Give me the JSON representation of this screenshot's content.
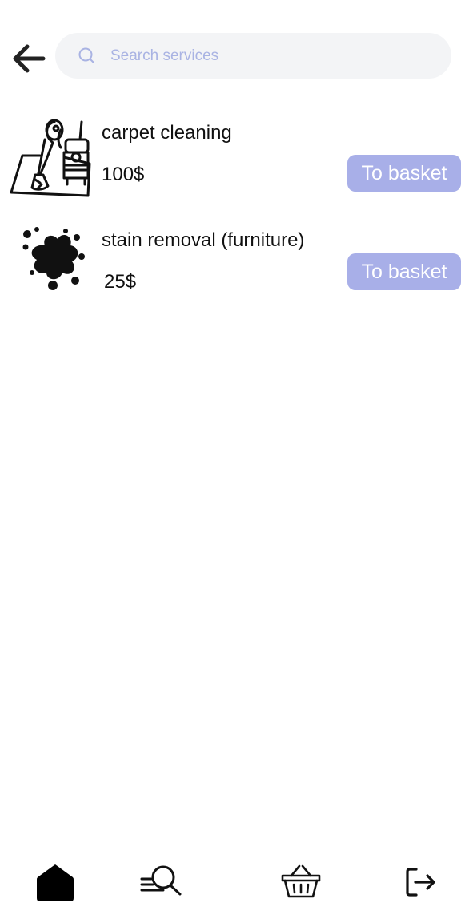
{
  "search": {
    "placeholder": "Search services",
    "value": ""
  },
  "services": [
    {
      "name": "carpet cleaning",
      "price": "100$",
      "button_label": "To basket",
      "icon": "carpet-cleaning-icon"
    },
    {
      "name": "stain removal (furniture)",
      "price": "25$",
      "button_label": "To basket",
      "icon": "stain-icon"
    }
  ],
  "bottom_nav": [
    {
      "icon": "home-icon"
    },
    {
      "icon": "search-services-icon"
    },
    {
      "icon": "basket-icon"
    },
    {
      "icon": "logout-icon"
    }
  ],
  "colors": {
    "accent": "#a8afe8",
    "placeholder": "#a9b3e3",
    "search_bg": "#f3f4f6",
    "text": "#111111"
  }
}
